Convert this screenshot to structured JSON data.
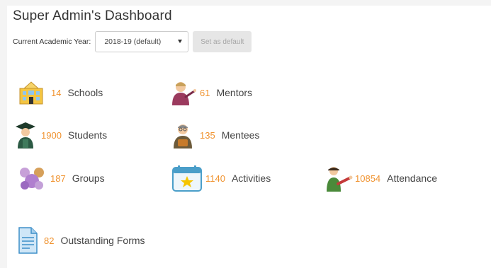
{
  "title": "Super Admin's Dashboard",
  "academic_year": {
    "label": "Current Academic Year:",
    "selected": "2018-19 (default)",
    "set_default_label": "Set as default"
  },
  "stats": [
    {
      "icon": "school-building-icon",
      "value": "14",
      "label": "Schools"
    },
    {
      "icon": "mentor-icon",
      "value": "61",
      "label": "Mentors"
    },
    {
      "icon": "graduate-student-icon",
      "value": "1900",
      "label": "Students"
    },
    {
      "icon": "mentee-icon",
      "value": "135",
      "label": "Mentees"
    },
    {
      "icon": "group-icon",
      "value": "187",
      "label": "Groups"
    },
    {
      "icon": "calendar-icon",
      "value": "1140",
      "label": "Activities"
    },
    {
      "icon": "attendance-icon",
      "value": "10854",
      "label": "Attendance"
    },
    {
      "icon": "document-icon",
      "value": "82",
      "label": "Outstanding Forms"
    }
  ],
  "colors": {
    "accent_number": "#f0922e",
    "background": "#f4f4f4",
    "panel": "#ffffff"
  }
}
